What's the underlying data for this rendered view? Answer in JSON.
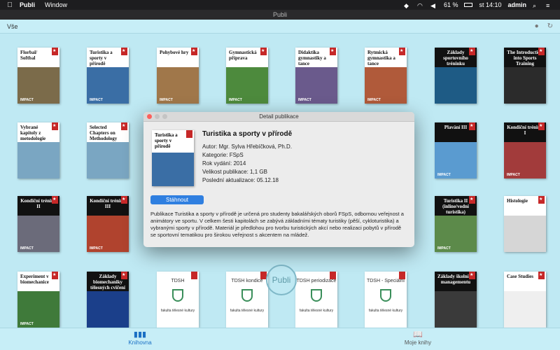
{
  "menubar": {
    "app": "Publi",
    "menus": [
      "Window"
    ],
    "battery": "61 %",
    "clock": "st 14:10",
    "user": "admin",
    "icons": [
      "apple-icon",
      "dropbox-icon",
      "wifi-icon",
      "volume-icon",
      "battery-icon",
      "search-icon",
      "menu-icon"
    ]
  },
  "window": {
    "title": "Publi"
  },
  "toolbar": {
    "filter_label": "Vše",
    "icons": [
      "user-icon",
      "refresh-icon"
    ]
  },
  "books": [
    {
      "title": "Florbal/ Softbal",
      "style": "white",
      "photo": "#7b6b4a",
      "impact": true
    },
    {
      "title": "Turistika a sporty v přírodě",
      "style": "white",
      "photo": "#3a6ea5",
      "impact": true
    },
    {
      "title": "Pohybové hry",
      "style": "white",
      "photo": "#a0774a",
      "impact": true
    },
    {
      "title": "Gymnastická příprava",
      "style": "white",
      "photo": "#4d8a3d",
      "impact": true
    },
    {
      "title": "Didaktika gymnastiky a tance",
      "style": "white",
      "photo": "#6a5a8c",
      "impact": true
    },
    {
      "title": "Rytmická gymnastika a tance",
      "style": "white",
      "photo": "#b05a3a",
      "impact": true
    },
    {
      "title": "Základy sportovního tréninku",
      "style": "dark",
      "photo": "#1e5b85",
      "impact": false
    },
    {
      "title": "The Introduction into Sports Training",
      "style": "dark",
      "photo": "#2b2b2b",
      "impact": false
    },
    {
      "title": "Vybrané kapitoly z metodologie",
      "style": "white",
      "photo": "#7aa6c2",
      "impact": false
    },
    {
      "title": "Selected Chapters on Methodology",
      "style": "white",
      "photo": "#7aa6c2",
      "impact": false
    },
    {
      "title": "Plavání III",
      "style": "dark",
      "photo": "#5a9bd0",
      "impact": true
    },
    {
      "title": "Kondiční trénink I",
      "style": "dark",
      "photo": "#a23b3b",
      "impact": true
    },
    {
      "title": "Kondiční trénink II",
      "style": "dark",
      "photo": "#6b6b7a",
      "impact": true
    },
    {
      "title": "Kondiční trénink III",
      "style": "dark",
      "photo": "#b0432e",
      "impact": true
    },
    {
      "title": "Turistika II (inline/vodní turistika)",
      "style": "dark",
      "photo": "#5c8a4a",
      "impact": true
    },
    {
      "title": "Histologie",
      "style": "white",
      "photo": "#d6d6d6",
      "impact": false
    },
    {
      "title": "Experiment v biomechanice",
      "style": "white",
      "photo": "#3f7a3a",
      "impact": true
    },
    {
      "title": "Základy biomechaniky tělesných cvičení",
      "style": "dark",
      "photo": "#1b3f8a",
      "impact": false
    },
    {
      "title": "Základy školního managementu",
      "style": "dark",
      "photo": "#3a3a3a",
      "impact": false
    },
    {
      "title": "Case Studies",
      "style": "white",
      "photo": "#efefef",
      "impact": false
    }
  ],
  "tdsh": [
    {
      "title": "TDSH",
      "sub": "fakulta tělesné kultury"
    },
    {
      "title": "TDSH kondice",
      "sub": "fakulta tělesné kultury"
    },
    {
      "title": "TDSH periodizace",
      "sub": "fakulta tělesné kultury"
    },
    {
      "title": "TDSH - Speciální",
      "sub": "fakulta tělesné kultury"
    }
  ],
  "watermark": "Publi",
  "dialog": {
    "title": "Detail publikace",
    "cover_title": "Turistika a sporty v přírodě",
    "book_title": "Turistika a sporty v přírodě",
    "author": "Autor: Mgr. Sylva Hřebíčková, Ph.D.",
    "category": "Kategorie: FSpS",
    "year": "Rok vydání: 2014",
    "size": "Velikost publikace: 1,1 GB",
    "updated": "Poslední aktualizace: 05.12.18",
    "download_label": "Stáhnout",
    "description": "Publikace Turistika a sporty v přírodě je určená pro studenty bakalářských oborů FSpS, odbornou veřejnost a animátory ve sportu. V celkem šesti kapitolách se zabývá základními  tématy turistiky (pěší, cykloturistika) a vybranými sporty v přírodě. Materiál je předlohou pro tvorbu turistických akcí nebo realizaci pobytů v přírodě se sportovní tematikou pro širokou veřejnost s akcentem na mládež."
  },
  "tabs": [
    {
      "label": "Knihovna",
      "icon": "library-icon",
      "active": true
    },
    {
      "label": "Moje knihy",
      "icon": "book-icon",
      "active": false
    }
  ],
  "colors": {
    "background": "#bfe9f3",
    "accent": "#2f7fe0",
    "ribbon": "#c62828"
  }
}
